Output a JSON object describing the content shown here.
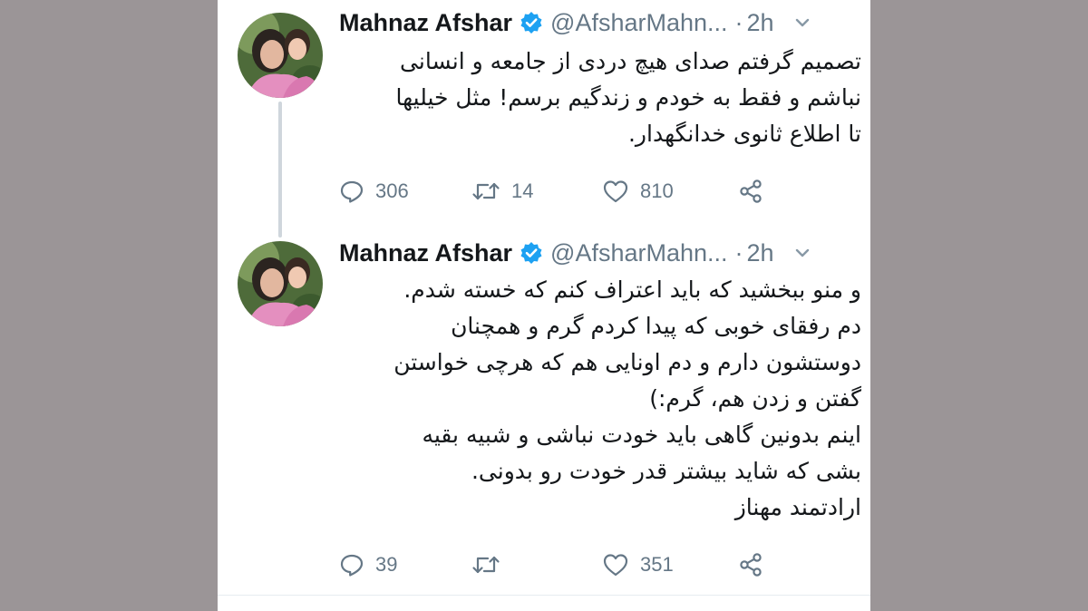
{
  "colors": {
    "background": "#9b9597",
    "card": "#ffffff",
    "verified": "#1da1f2",
    "muted": "#657786",
    "text": "#14171a"
  },
  "tweets": [
    {
      "author_name": "Mahnaz Afshar",
      "handle": "@AfsharMahn...",
      "separator": "·",
      "time": "2h",
      "lines": [
        "تصمیم گرفتم صدای هیچ دردی از جامعه و انسانی",
        "نباشم و فقط به خودم و زندگیم برسم! مثل خیلیها",
        "تا اطلاع ثانوی خدانگهدار."
      ],
      "stats": {
        "replies": "306",
        "retweets": "14",
        "likes": "810"
      },
      "icons": [
        "verified-badge-icon",
        "chevron-down-icon",
        "reply-icon",
        "retweet-icon",
        "like-icon",
        "share-icon"
      ]
    },
    {
      "author_name": "Mahnaz Afshar",
      "handle": "@AfsharMahn...",
      "separator": "·",
      "time": "2h",
      "lines": [
        "و منو ببخشید که باید اعتراف کنم که خسته شدم.",
        "دم رفقای خوبی که پیدا کردم گرم و همچنان",
        "دوستشون دارم و دم اونایی هم که هرچی خواستن",
        "گفتن و زدن هم، گرم:)",
        "اینم بدونین گاهی باید خودت نباشی و شبیه بقیه",
        "بشی که شاید بیشتر قدر خودت رو بدونی.",
        "ارادتمند مهناز"
      ],
      "stats": {
        "replies": "39",
        "retweets": "",
        "likes": "351"
      },
      "icons": [
        "verified-badge-icon",
        "chevron-down-icon",
        "reply-icon",
        "retweet-icon",
        "like-icon",
        "share-icon"
      ]
    }
  ]
}
